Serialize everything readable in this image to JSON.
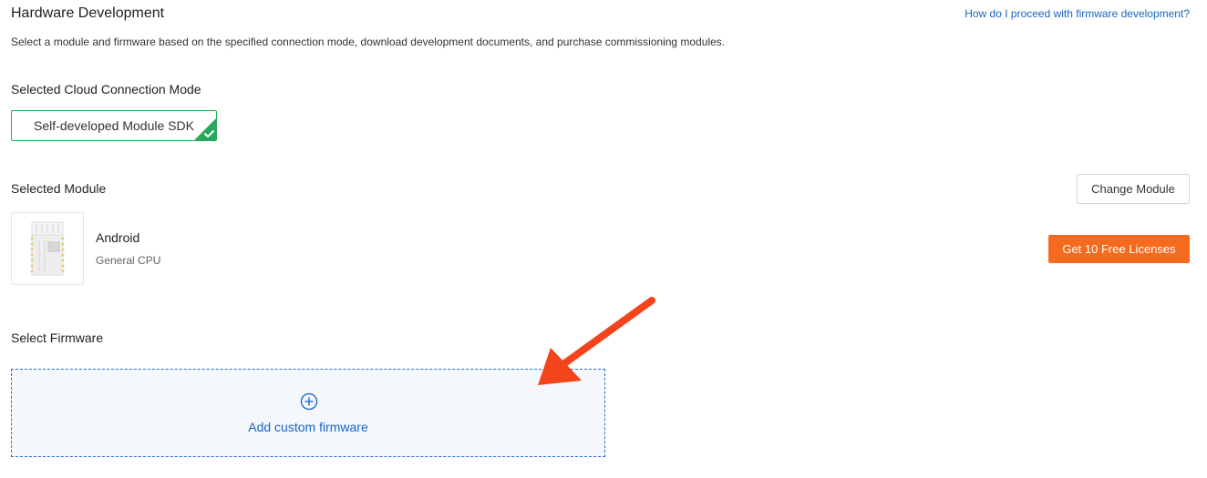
{
  "header": {
    "title": "Hardware Development",
    "help_link": "How do I proceed with firmware development?",
    "description": "Select a module and firmware based on the specified connection mode, download development documents, and purchase commissioning modules."
  },
  "connection_mode": {
    "label": "Selected Cloud Connection Mode",
    "selected": "Self-developed Module SDK"
  },
  "module": {
    "label": "Selected Module",
    "change_button": "Change Module",
    "name": "Android",
    "subtitle": "General CPU",
    "licenses_button": "Get 10 Free Licenses"
  },
  "firmware": {
    "label": "Select Firmware",
    "add_label": "Add custom firmware"
  },
  "colors": {
    "accent_blue": "#1764c7",
    "selected_green": "#27a85c",
    "primary_orange": "#f56a1e",
    "annotation_red": "#f4441c"
  },
  "icons": {
    "check": "checkmark-icon",
    "add": "plus-circle-icon",
    "annotation": "red-arrow-pointer"
  }
}
